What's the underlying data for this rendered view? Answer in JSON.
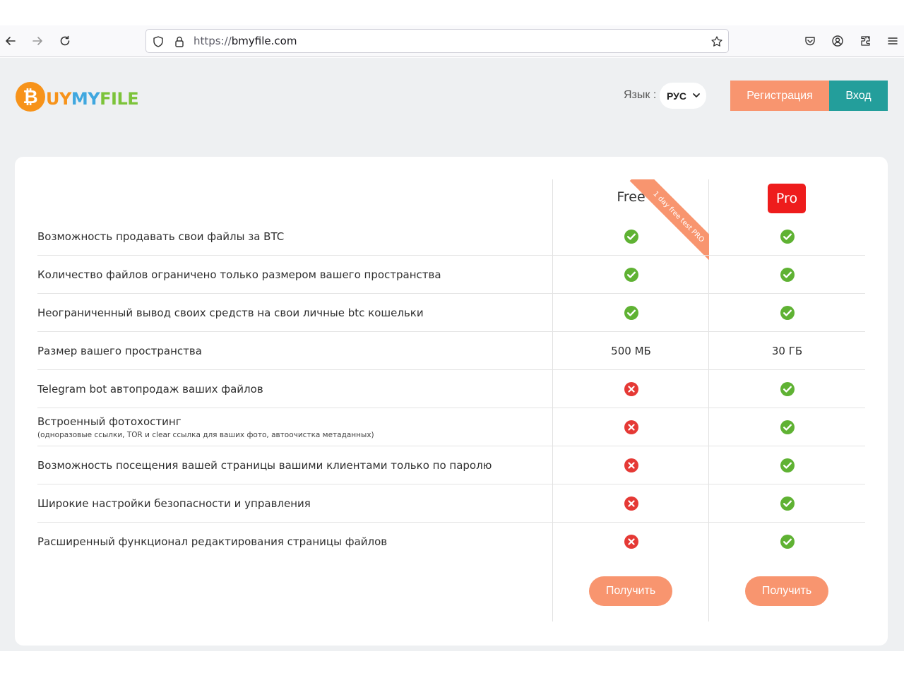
{
  "browser": {
    "url_scheme": "https://",
    "url_host": "bmyfile.com"
  },
  "header": {
    "logo_letter": "₿",
    "logo_u": "UY",
    "logo_my": "MY",
    "logo_file": "FILE",
    "lang_label": "Язык :",
    "lang_value": "РУС",
    "register_label": "Регистрация",
    "login_label": "Вход"
  },
  "plans": {
    "free_label": "Free",
    "pro_label": "Pro",
    "ribbon_text": "1 day free test PRO",
    "get_label_free": "Получить",
    "get_label_pro": "Получить"
  },
  "features": [
    {
      "label": "Возможность продавать свои файлы за BTC",
      "note": "",
      "free": "yes",
      "pro": "yes",
      "free_text": "",
      "pro_text": ""
    },
    {
      "label": "Количество файлов ограничено только размером вашего пространства",
      "note": "",
      "free": "yes",
      "pro": "yes",
      "free_text": "",
      "pro_text": ""
    },
    {
      "label": "Неограниченный вывод своих средств на свои личные btc кошельки",
      "note": "",
      "free": "yes",
      "pro": "yes",
      "free_text": "",
      "pro_text": ""
    },
    {
      "label": "Размер вашего пространства",
      "note": "",
      "free": "text",
      "pro": "text",
      "free_text": "500 МБ",
      "pro_text": "30 ГБ"
    },
    {
      "label": "Telegram bot автопродаж ваших файлов",
      "note": "",
      "free": "no",
      "pro": "yes",
      "free_text": "",
      "pro_text": ""
    },
    {
      "label": "Встроенный фотохостинг",
      "note": "(одноразовые ссылки, TOR и clear ссылка для ваших фото, автоочистка метаданных)",
      "free": "no",
      "pro": "yes",
      "free_text": "",
      "pro_text": ""
    },
    {
      "label": "Возможность посещения вашей страницы вашими клиентами только по паролю",
      "note": "",
      "free": "no",
      "pro": "yes",
      "free_text": "",
      "pro_text": ""
    },
    {
      "label": "Широкие настройки безопасности и управления",
      "note": "",
      "free": "no",
      "pro": "yes",
      "free_text": "",
      "pro_text": ""
    },
    {
      "label": "Расширенный функционал редактирования страницы файлов",
      "note": "",
      "free": "no",
      "pro": "yes",
      "free_text": "",
      "pro_text": ""
    }
  ],
  "colors": {
    "accent": "#f8956f",
    "login": "#239e9b",
    "pro_badge": "#ee1c1c",
    "check": "#5fb233",
    "cross": "#e53935"
  }
}
